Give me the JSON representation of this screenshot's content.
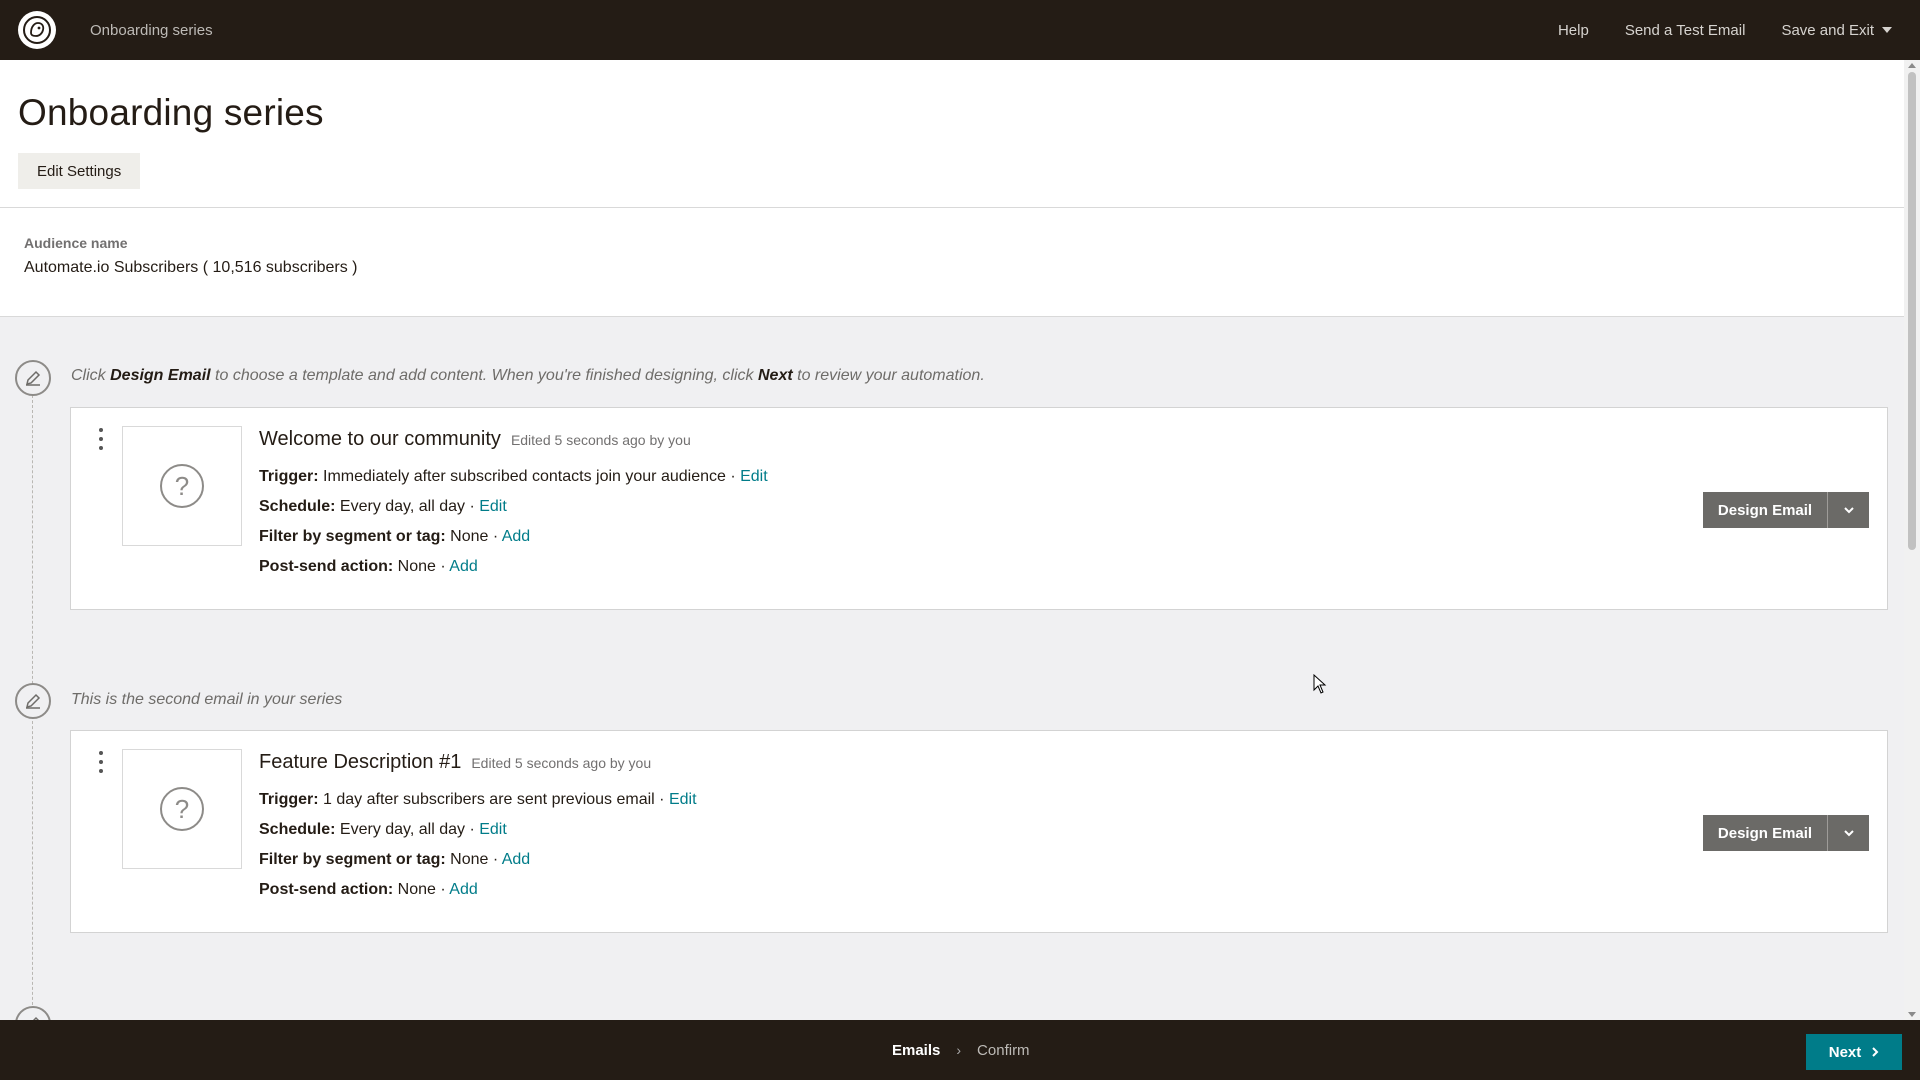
{
  "topbar": {
    "crumb": "Onboarding series",
    "help": "Help",
    "send_test": "Send a Test Email",
    "save_exit": "Save and Exit"
  },
  "header": {
    "title": "Onboarding series",
    "edit_settings": "Edit Settings"
  },
  "audience": {
    "label": "Audience name",
    "value": "Automate.io Subscribers ( 10,516 subscribers )"
  },
  "hints": {
    "first_pre": "Click ",
    "first_b1": "Design Email",
    "first_mid": " to choose a template and add content. When you're finished designing, click ",
    "first_b2": "Next",
    "first_post": " to review your automation.",
    "second": "This is the second email in your series"
  },
  "emails": [
    {
      "name": "Welcome to our community",
      "edited": "Edited 5 seconds ago by you",
      "trigger_label": "Trigger:",
      "trigger_value": " Immediately after subscribed contacts join your audience · ",
      "trigger_link": "Edit",
      "schedule_label": "Schedule:",
      "schedule_value": " Every day, all day · ",
      "schedule_link": "Edit",
      "filter_label": "Filter by segment or tag:",
      "filter_value": " None · ",
      "filter_link": "Add",
      "post_label": "Post-send action:",
      "post_value": " None · ",
      "post_link": "Add",
      "design_label": "Design Email"
    },
    {
      "name": "Feature Description #1",
      "edited": "Edited 5 seconds ago by you",
      "trigger_label": "Trigger:",
      "trigger_value": " 1 day after subscribers are sent previous email · ",
      "trigger_link": "Edit",
      "schedule_label": "Schedule:",
      "schedule_value": " Every day, all day · ",
      "schedule_link": "Edit",
      "filter_label": "Filter by segment or tag:",
      "filter_value": " None · ",
      "filter_link": "Add",
      "post_label": "Post-send action:",
      "post_value": " None · ",
      "post_link": "Add",
      "design_label": "Design Email"
    }
  ],
  "bottombar": {
    "step_emails": "Emails",
    "step_confirm": "Confirm",
    "next": "Next"
  },
  "colors": {
    "dark": "#241c15",
    "link": "#007c89",
    "button_gray": "#6b6a67"
  }
}
